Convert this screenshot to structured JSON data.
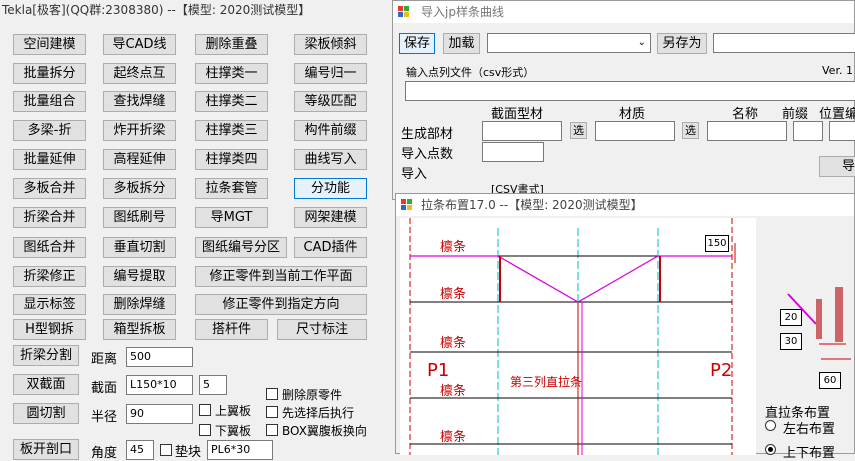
{
  "left_panel": {
    "title": "Tekla[极客](QQ群:2308380) --【模型: 2020测试模型】",
    "rows": [
      [
        "空间建模",
        "导CAD线",
        "删除重叠",
        "梁板倾斜"
      ],
      [
        "批量拆分",
        "起终点互",
        "柱撑类一",
        "编号归一"
      ],
      [
        "批量组合",
        "查找焊缝",
        "柱撑类二",
        "等级匹配"
      ],
      [
        "多梁-折",
        "炸开折梁",
        "柱撑类三",
        "构件前缀"
      ],
      [
        "批量延伸",
        "高程延伸",
        "柱撑类四",
        "曲线写入"
      ],
      [
        "多板合并",
        "多板拆分",
        "拉条套管",
        "分功能"
      ],
      [
        "折梁合并",
        "图纸刷号",
        "导MGT",
        "网架建模"
      ]
    ],
    "row8": [
      "图纸合并",
      "垂直切割",
      "图纸编号分区",
      "CAD插件"
    ],
    "row9": [
      "折梁修正",
      "编号提取",
      "修正零件到当前工作平面"
    ],
    "row10": [
      "显示标签",
      "删除焊缝",
      "修正零件到指定方向"
    ],
    "row11": [
      "H型钢拆",
      "箱型拆板",
      "搭杆件",
      "尺寸标注"
    ],
    "split_beam": {
      "button": "折梁分割",
      "label": "距离",
      "value": "500"
    },
    "double_section": {
      "button": "双截面",
      "label": "截面",
      "value": "L150*10",
      "count": "5",
      "delete_original": "删除原零件"
    },
    "arc_cut": {
      "button": "圆切割",
      "label": "半径",
      "value": "90",
      "upper": "上翼板",
      "lower": "下翼板",
      "select_first": "先选择后执行",
      "box_flange": "BOX翼腹板换向"
    },
    "plate_open": {
      "button": "板开剖口",
      "angle_label": "角度",
      "angle": "45",
      "pad_label": "垫块",
      "pad": "PL6*30"
    }
  },
  "import_window": {
    "title": "导入jp样条曲线",
    "save": "保存",
    "load": "加载",
    "save_as": "另存为",
    "file_label": "输入点列文件（csv形式）",
    "version": "Ver. 1",
    "headers": {
      "section": "截面型材",
      "material": "材质",
      "name": "名称",
      "prefix": "前缀",
      "position": "位置编"
    },
    "generate": "生成部材",
    "select": "选",
    "import_count": "导入点数",
    "import_label": "导入",
    "import_button": "导",
    "csv_format": "[CSV書式]"
  },
  "tie_window": {
    "title": "拉条布置17.0 --【模型: 2020测试模型】",
    "purlin": "檩条",
    "p1": "P1",
    "p2": "P2",
    "third_col": "第三列直拉条",
    "dim150": "150",
    "dim20": "20",
    "dim30": "30",
    "dim60": "60",
    "layout_label": "直拉条布置",
    "opt_lr": "左右布置",
    "opt_ud": "上下布置"
  }
}
